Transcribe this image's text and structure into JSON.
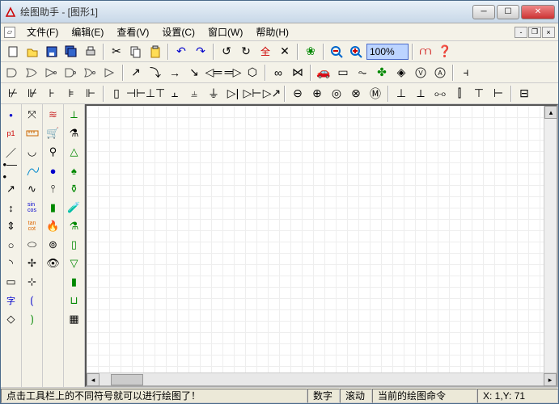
{
  "window": {
    "title": "绘图助手 - [图形1]"
  },
  "menu": {
    "file": "文件(F)",
    "edit": "编辑(E)",
    "view": "查看(V)",
    "settings": "设置(C)",
    "window": "窗口(W)",
    "help": "帮助(H)"
  },
  "toolbar1": {
    "zoom_value": "100%"
  },
  "status": {
    "hint": "点击工具栏上的不同符号就可以进行绘图了！",
    "numlock": "数字",
    "scroll": "滚动",
    "cmdlabel": "当前的绘图命令",
    "coords": "X:    1,Y:   71"
  }
}
